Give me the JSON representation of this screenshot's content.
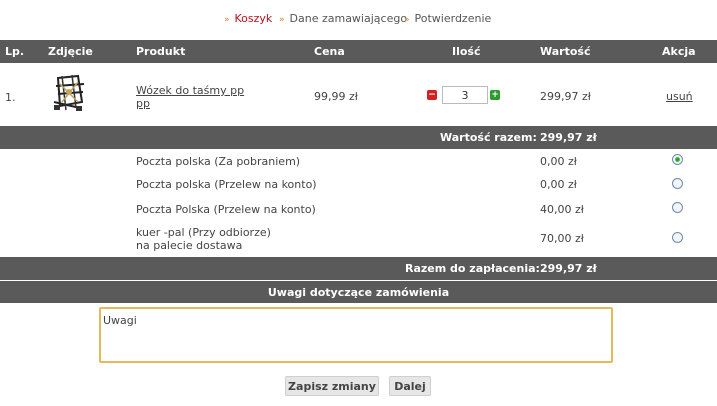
{
  "breadcrumb": [
    {
      "label": "Koszyk",
      "active": true
    },
    {
      "label": "Dane zamawiającego",
      "active": false
    },
    {
      "label": "Potwierdzenie",
      "active": false
    }
  ],
  "table": {
    "headers": {
      "lp": "Lp.",
      "photo": "Zdjęcie",
      "product": "Produkt",
      "price": "Cena",
      "qty": "Ilość",
      "value": "Wartość",
      "action": "Akcja"
    },
    "rows": [
      {
        "lp": "1.",
        "product_line1": "Wózek do taśmy pp",
        "product_line2": "pp",
        "price": "99,99 zł",
        "qty": "3",
        "value": "299,97 zł",
        "action": "usuń"
      }
    ]
  },
  "summary": {
    "label": "Wartość razem:",
    "value": "299,97 zł"
  },
  "shipping": [
    {
      "label": "Poczta polska (Za pobraniem)",
      "label2": "",
      "price": "0,00 zł",
      "selected": true
    },
    {
      "label": "Poczta polska (Przelew na konto)",
      "label2": "",
      "price": "0,00 zł",
      "selected": false
    },
    {
      "label": "Poczta Polska (Przelew na konto)",
      "label2": "",
      "price": "40,00 zł",
      "selected": false
    },
    {
      "label": "kuer -pal (Przy odbiorze)",
      "label2": "na palecie dostawa",
      "price": "70,00 zł",
      "selected": false
    }
  ],
  "total": {
    "label": "Razem do zapłacenia:",
    "value": "299,97 zł"
  },
  "notes": {
    "header": "Uwagi dotyczące zamówienia",
    "value": "Uwagi"
  },
  "buttons": {
    "save": "Zapisz zmiany",
    "next": "Dalej"
  },
  "colors": {
    "bar": "#5a5a5a",
    "active_crumb": "#b5121b",
    "arrow": "#e07a2a",
    "notes_border": "#e8b85a"
  }
}
